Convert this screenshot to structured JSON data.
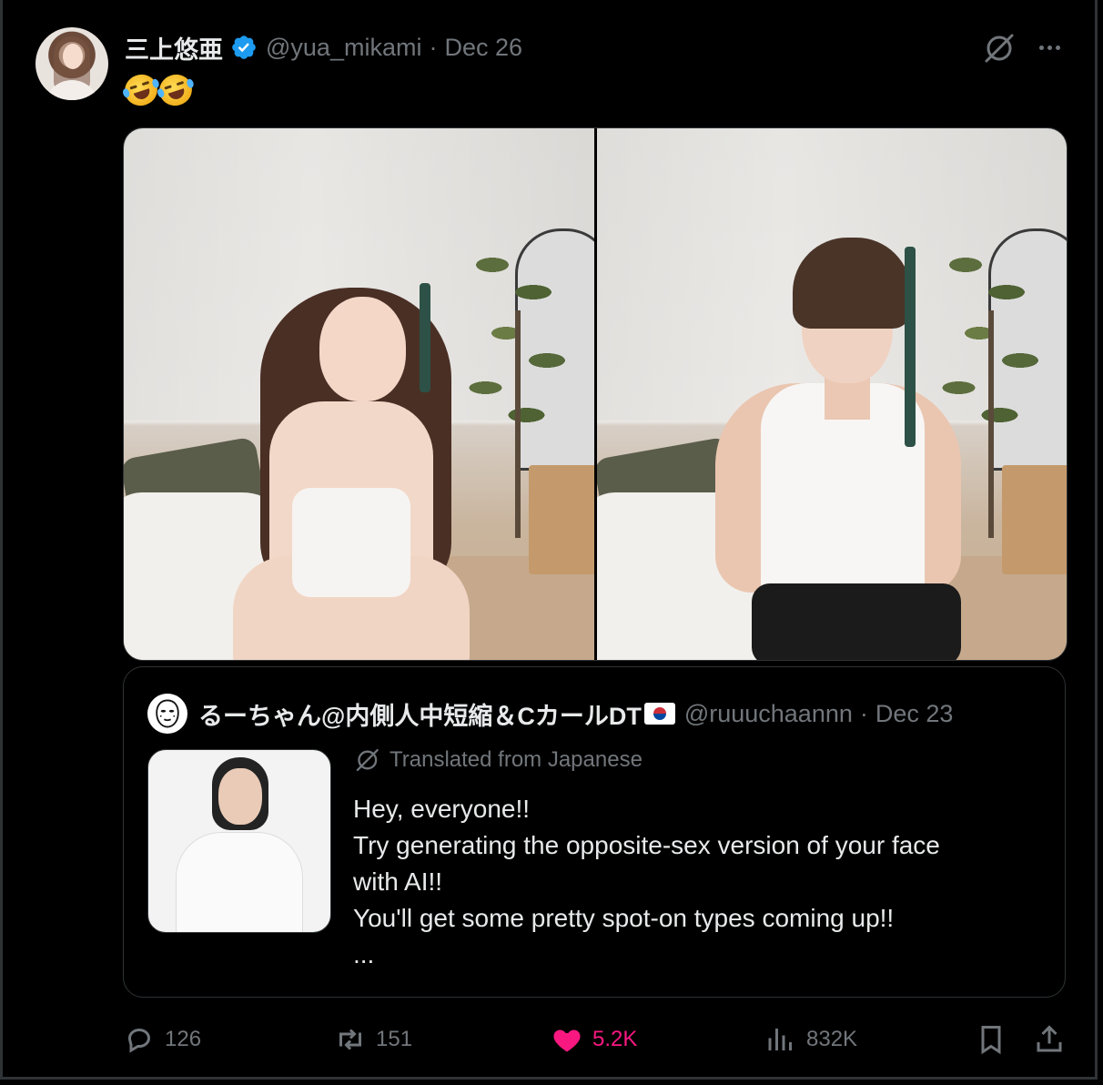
{
  "post": {
    "author_name": "三上悠亜",
    "handle": "@yua_mikami",
    "separator": "·",
    "date": "Dec 26",
    "text_emojis": [
      "🤣",
      "🤣"
    ]
  },
  "quote": {
    "author_name": "るーちゃん@内側人中短縮＆CカールDT",
    "flag": "🇰🇷",
    "handle": "@ruuuchaannn",
    "separator": "·",
    "date": "Dec 23",
    "translated_label": "Translated from Japanese",
    "lines": [
      "Hey, everyone!!",
      "Try generating the opposite-sex version of your face",
      "with AI!!",
      "You'll get some pretty spot-on types coming up!!",
      "..."
    ]
  },
  "actions": {
    "replies": "126",
    "reposts": "151",
    "likes": "5.2K",
    "views": "832K"
  },
  "colors": {
    "background": "#000000",
    "text_primary": "#e7e9ea",
    "text_secondary": "#71767b",
    "verified": "#1d9bf0",
    "like_active": "#f91880",
    "border": "#2f3336"
  },
  "icons": [
    "verified-badge-icon",
    "grok-icon",
    "more-icon",
    "reply-icon",
    "repost-icon",
    "like-icon",
    "views-icon",
    "bookmark-icon",
    "share-icon",
    "translate-icon",
    "face-mask-icon"
  ]
}
